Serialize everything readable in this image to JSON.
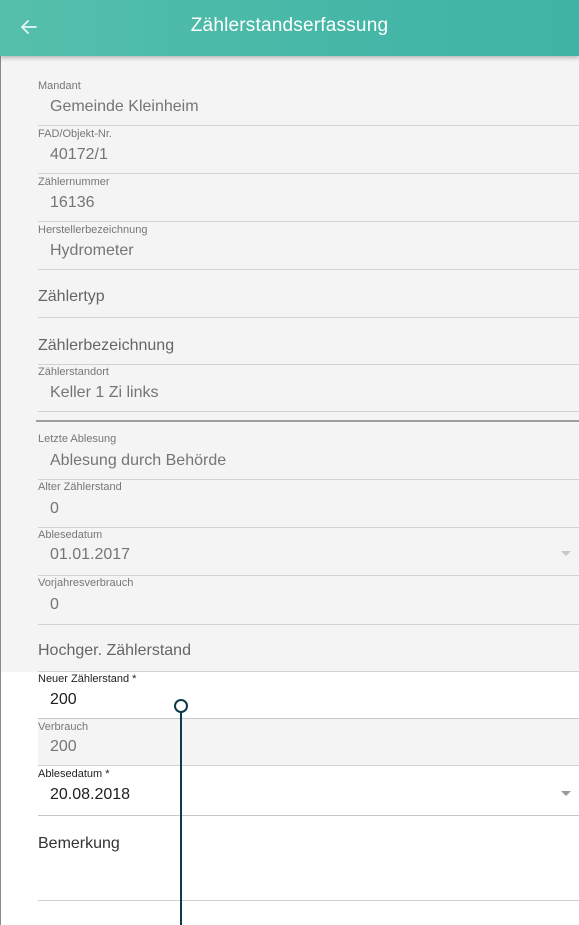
{
  "header": {
    "title": "Zählerstandserfassung",
    "back_icon": "arrow-left-icon",
    "colors": {
      "bar": "#46b7a7",
      "title": "#ffffff"
    }
  },
  "fields": {
    "mandant": {
      "label": "Mandant",
      "value": "Gemeinde Kleinheim"
    },
    "fad_objekt": {
      "label": "FAD/Objekt-Nr.",
      "value": "40172/1"
    },
    "zaehlernummer": {
      "label": "Zählernummer",
      "value": "16136"
    },
    "herstellerbezeichnung": {
      "label": "Herstellerbezeichnung",
      "value": "Hydrometer"
    },
    "zaehlertyp": {
      "placeholder": "Zählertyp"
    },
    "zaehlerbezeichnung": {
      "placeholder": "Zählerbezeichnung"
    },
    "zaehlerstandort": {
      "label": "Zählerstandort",
      "value": "Keller 1 Zi links"
    },
    "letzte_ablesung": {
      "label": "Letzte Ablesung",
      "value": "Ablesung durch Behörde"
    },
    "alter_zaehlerstand": {
      "label": "Alter Zählerstand",
      "value": "0"
    },
    "ablesedatum_alt": {
      "label": "Ablesedatum",
      "value": "01.01.2017"
    },
    "vorjahresverbrauch": {
      "label": "Vorjahresverbrauch",
      "value": "0"
    },
    "hochger_zaehlerstand": {
      "placeholder": "Hochger. Zählerstand"
    },
    "neuer_zaehlerstand": {
      "label": "Neuer Zählerstand *",
      "value": "200"
    },
    "verbrauch": {
      "label": "Verbrauch",
      "value": "200"
    },
    "ablesedatum_neu": {
      "label": "Ablesedatum *",
      "value": "20.08.2018"
    },
    "bemerkung": {
      "placeholder": "Bemerkung"
    }
  }
}
